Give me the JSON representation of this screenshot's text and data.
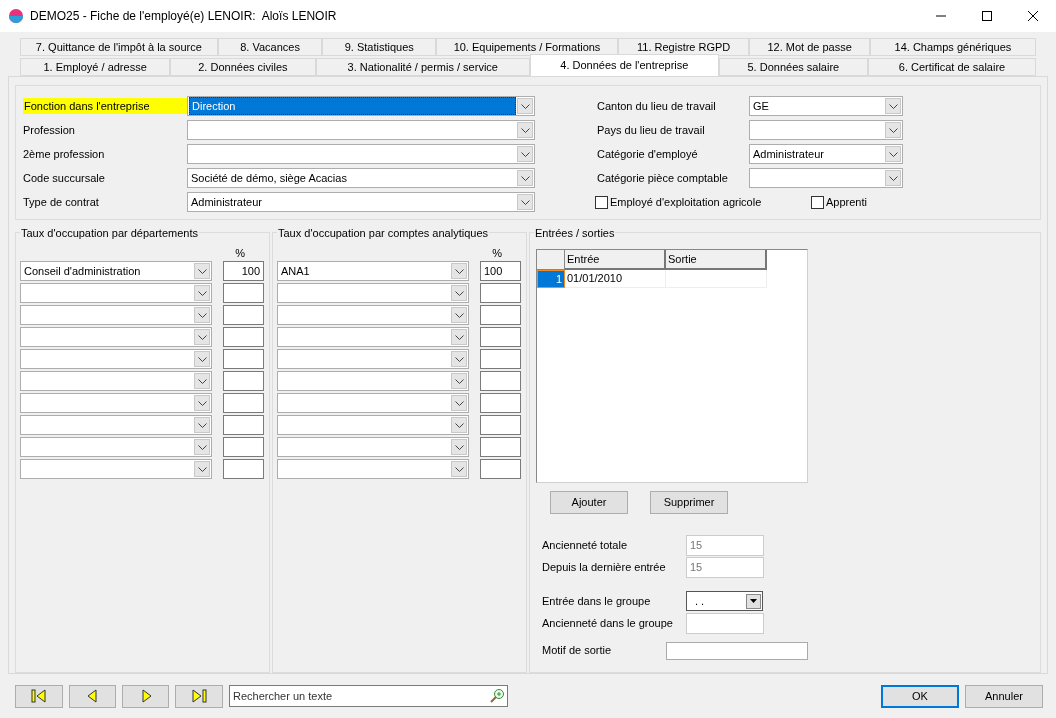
{
  "window": {
    "title": "DEMO25 - Fiche de l'employé(e) LENOIR:  Aloïs LENOIR"
  },
  "tabs_back": [
    {
      "label": "7. Quittance de l'impôt à la source",
      "selected": false
    },
    {
      "label": "8. Vacances",
      "selected": false
    },
    {
      "label": "9. Statistiques",
      "selected": false
    },
    {
      "label": "10. Equipements / Formations",
      "selected": false
    },
    {
      "label": "11. Registre RGPD",
      "selected": false
    },
    {
      "label": "12. Mot de passe",
      "selected": false
    },
    {
      "label": "14. Champs génériques",
      "selected": false
    }
  ],
  "tabs_front": [
    {
      "label": "1. Employé / adresse",
      "selected": false
    },
    {
      "label": "2. Données civiles",
      "selected": false
    },
    {
      "label": "3. Nationalité / permis / service",
      "selected": false
    },
    {
      "label": "4. Données de l'entreprise",
      "selected": true
    },
    {
      "label": "5. Données salaire",
      "selected": false
    },
    {
      "label": "6. Certificat de salaire",
      "selected": false
    }
  ],
  "form_left": [
    {
      "label": "Fonction dans l'entreprise",
      "value": "Direction",
      "highlighted": true,
      "focused": true
    },
    {
      "label": "Profession",
      "highlighted": false,
      "focused": false
    },
    {
      "label": "2ème profession",
      "highlighted": false,
      "focused": false
    },
    {
      "label": "Code succursale",
      "value": "Société de démo, siège Acacias",
      "highlighted": false,
      "focused": false
    },
    {
      "label": "Type de contrat",
      "value": "Administrateur",
      "highlighted": false,
      "focused": false
    }
  ],
  "form_right": [
    {
      "label": "Canton du lieu de travail",
      "value": "GE"
    },
    {
      "label": "Pays du lieu de travail"
    },
    {
      "label": "Catégorie d'employé",
      "value": "Administrateur"
    },
    {
      "label": "Catégorie pièce comptable"
    }
  ],
  "checkboxes": [
    {
      "label": "Employé d'exploitation agricole",
      "checked": false
    },
    {
      "label": "Apprenti",
      "checked": false
    }
  ],
  "departments": {
    "title": "Taux d'occupation par départements",
    "percent_header": "%",
    "rows": [
      {
        "value": "Conseil d'administration",
        "percent": "100"
      },
      {},
      {},
      {},
      {},
      {},
      {},
      {},
      {},
      {}
    ]
  },
  "analytics": {
    "title": "Taux d'occupation par comptes analytiques",
    "percent_header": "%",
    "rows": [
      {
        "value": "ANA1",
        "percent": "100"
      },
      {},
      {},
      {},
      {},
      {},
      {},
      {},
      {},
      {}
    ]
  },
  "entries": {
    "title": "Entrées / sorties",
    "columns": [
      "Entrée",
      "Sortie"
    ],
    "rows": [
      {
        "index": "1",
        "entree": "01/01/2010",
        "selected": true
      }
    ],
    "buttons": [
      "Ajouter",
      "Supprimer"
    ]
  },
  "seniority": [
    {
      "kind": "field",
      "label": "Ancienneté totale",
      "value": "15",
      "disabled": true
    },
    {
      "kind": "field",
      "label": "Depuis la dernière entrée",
      "value": "15",
      "disabled": true
    },
    {
      "kind": "date-combo",
      "label": "Entrée dans le groupe",
      "value": ". ."
    },
    {
      "kind": "field",
      "label": "Ancienneté dans le groupe"
    }
  ],
  "exit_reason": {
    "label": "Motif de sortie"
  },
  "search": {
    "placeholder": "Rechercher un texte"
  },
  "buttons": [
    {
      "label": "OK",
      "default": true
    },
    {
      "label": "Annuler",
      "default": false
    }
  ]
}
